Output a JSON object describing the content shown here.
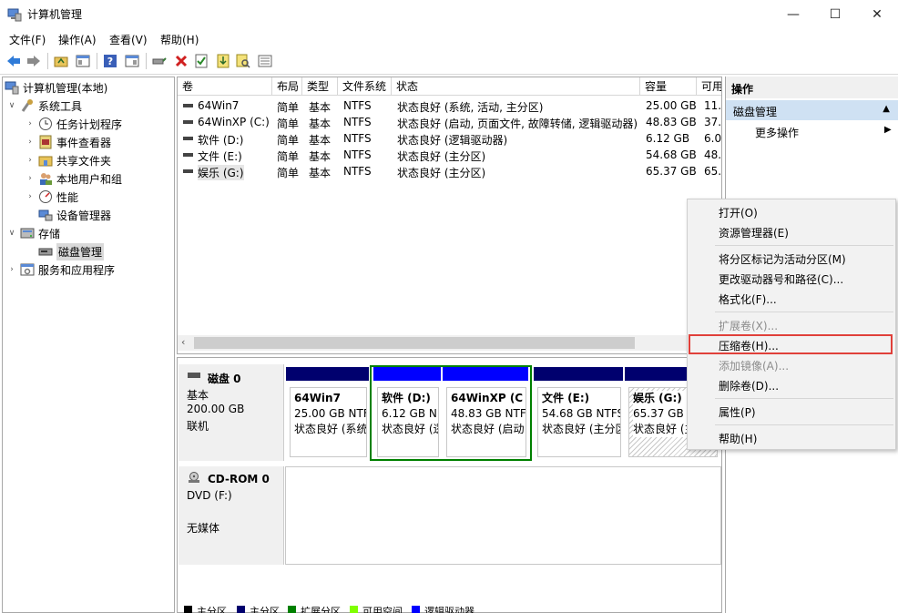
{
  "window": {
    "title": "计算机管理"
  },
  "menu": [
    "文件(F)",
    "操作(A)",
    "查看(V)",
    "帮助(H)"
  ],
  "toolbar": [
    "back-arrow-icon",
    "forward-arrow-icon",
    "up-folder-icon",
    "show-tree-icon",
    "help-icon",
    "properties-icon",
    "connect-drive-icon",
    "delete-icon",
    "check-icon",
    "export-icon",
    "search-icon",
    "list-icon"
  ],
  "tree": {
    "root": "计算机管理(本地)",
    "system_tools": "系统工具",
    "task_scheduler": "任务计划程序",
    "event_viewer": "事件查看器",
    "shared_folders": "共享文件夹",
    "local_users": "本地用户和组",
    "performance": "性能",
    "device_manager": "设备管理器",
    "storage": "存储",
    "disk_management": "磁盘管理",
    "services": "服务和应用程序"
  },
  "volume_columns": [
    "卷",
    "布局",
    "类型",
    "文件系统",
    "状态",
    "容量",
    "可用"
  ],
  "volumes": [
    {
      "name": "64Win7",
      "layout": "简单",
      "type": "基本",
      "fs": "NTFS",
      "status": "状态良好 (系统, 活动, 主分区)",
      "capacity": "25.00 GB",
      "free": "11."
    },
    {
      "name": "64WinXP  (C:)",
      "layout": "简单",
      "type": "基本",
      "fs": "NTFS",
      "status": "状态良好 (启动, 页面文件, 故障转储, 逻辑驱动器)",
      "capacity": "48.83 GB",
      "free": "37."
    },
    {
      "name": "软件 (D:)",
      "layout": "简单",
      "type": "基本",
      "fs": "NTFS",
      "status": "状态良好 (逻辑驱动器)",
      "capacity": "6.12 GB",
      "free": "6.0"
    },
    {
      "name": "文件 (E:)",
      "layout": "简单",
      "type": "基本",
      "fs": "NTFS",
      "status": "状态良好 (主分区)",
      "capacity": "54.68 GB",
      "free": "48."
    },
    {
      "name": "娱乐 (G:)",
      "layout": "简单",
      "type": "基本",
      "fs": "NTFS",
      "status": "状态良好 (主分区)",
      "capacity": "65.37 GB",
      "free": "65."
    }
  ],
  "disk0": {
    "name": "磁盘 0",
    "kind": "基本",
    "size": "200.00 GB",
    "state": "联机"
  },
  "cdrom0": {
    "name": "CD-ROM 0",
    "drive": "DVD (F:)",
    "state": "无媒体"
  },
  "partitions": [
    {
      "name": "64Win7",
      "size": "25.00 GB NTF",
      "status": "状态良好 (系统"
    },
    {
      "name": "软件  (D:)",
      "size": "6.12 GB N",
      "status": "状态良好 (逻"
    },
    {
      "name": "64WinXP  (C",
      "size": "48.83 GB NTF",
      "status": "状态良好 (启动"
    },
    {
      "name": "文件  (E:)",
      "size": "54.68 GB NTFS",
      "status": "状态良好 (主分区"
    },
    {
      "name": "娱乐  (G:)",
      "size": "65.37 GB NTF",
      "status": "状态良好 (主"
    }
  ],
  "legend": [
    "主分区",
    "主分区",
    "扩展分区",
    "可用空间",
    "逻辑驱动器"
  ],
  "colors": {
    "primary": "#000000",
    "primary_bar": "#00006e",
    "extended": "#008000",
    "free_space": "#80ff00",
    "logical": "#0000ff",
    "selected_outline": "#008000",
    "highlight": "#e0403a"
  },
  "actions": {
    "header": "操作",
    "selected": "磁盘管理",
    "more": "更多操作"
  },
  "context_menu": {
    "open": "打开(O)",
    "explorer": "资源管理器(E)",
    "mark_active": "将分区标记为活动分区(M)",
    "change_letter": "更改驱动器号和路径(C)...",
    "format": "格式化(F)...",
    "extend": "扩展卷(X)...",
    "shrink": "压缩卷(H)...",
    "add_mirror": "添加镜像(A)...",
    "delete": "删除卷(D)...",
    "properties": "属性(P)",
    "help": "帮助(H)"
  }
}
